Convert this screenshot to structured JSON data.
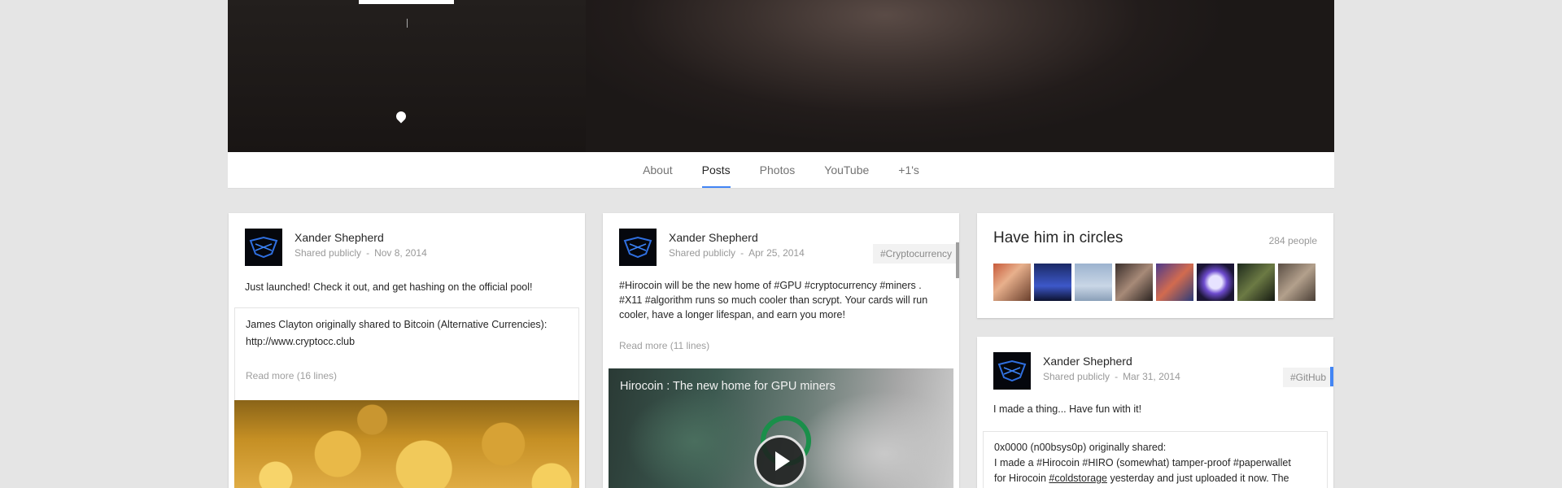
{
  "tabs": [
    {
      "label": "About"
    },
    {
      "label": "Posts"
    },
    {
      "label": "Photos"
    },
    {
      "label": "YouTube"
    },
    {
      "label": "+1's"
    }
  ],
  "active_tab": "Posts",
  "post1": {
    "author": "Xander Shepherd",
    "visibility": "Shared publicly",
    "date": "Nov 8, 2014",
    "text": "Just launched! Check it out, and get hashing on the official pool!",
    "reshare_author": "James Clayton",
    "reshare_text": " originally shared to Bitcoin (Alternative Currencies):",
    "reshare_link": "http://www.cryptocc.club",
    "read_more": "Read more (16 lines)"
  },
  "post2": {
    "author": "Xander Shepherd",
    "visibility": "Shared publicly",
    "date": "Apr 25, 2014",
    "hashtag": "#Cryptocurrency",
    "text_tag1": "#Hirocoin",
    "text_1": " will be the new home of ",
    "text_tag2": "#GPU",
    "text_tag3": "#cryptocurrency",
    "text_tag4": "#miners",
    "text_2": " .",
    "text_tag5": "#X11",
    "text_tag6": "#algorithm",
    "text_3": " runs so much cooler than scrypt. Your cards will run cooler, have a longer lifespan, and earn you more!",
    "read_more": "Read more (11 lines)",
    "video_title": "Hirocoin : The new home for GPU miners"
  },
  "circles": {
    "title": "Have him in circles",
    "count": "284 people"
  },
  "post3": {
    "author": "Xander Shepherd",
    "visibility": "Shared publicly",
    "date": "Mar 31, 2014",
    "hashtag": "#GitHub",
    "text": "I made a thing... Have fun with it!",
    "reshare_author": "0x0000 (n00bsys0p)",
    "reshare_suffix": " originally shared:",
    "reshare_1": "I made a ",
    "reshare_tag1": "#Hirocoin",
    "reshare_tag2": "#HIRO",
    "reshare_2": " (somewhat) tamper-proof ",
    "reshare_tag3": "#paperwallet",
    "reshare_3": "for Hirocoin ",
    "reshare_tag4": "#coldstorage",
    "reshare_4": " yesterday and just uploaded it now. The"
  },
  "colors": {
    "accent": "#4285f4",
    "text": "#262626",
    "muted": "#999999"
  }
}
